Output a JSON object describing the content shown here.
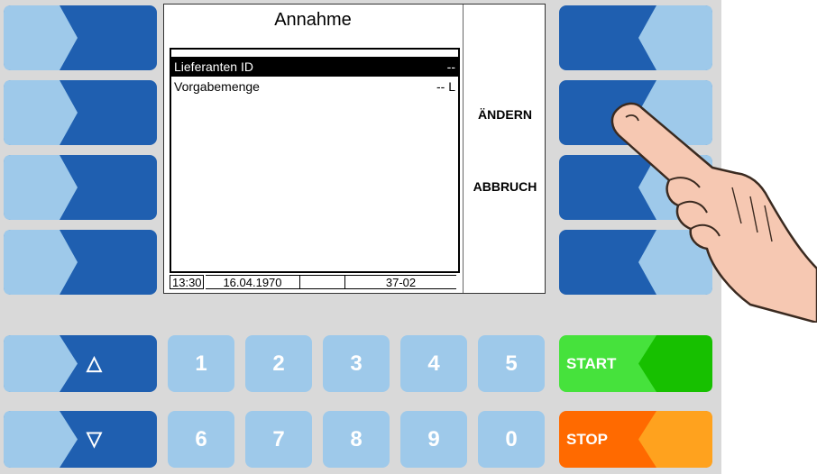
{
  "screen": {
    "title": "Annahme",
    "rows": [
      {
        "label": "Lieferanten ID",
        "value": "--",
        "selected": true
      },
      {
        "label": "Vorgabemenge",
        "value": "-- L",
        "selected": false
      }
    ],
    "softkeys": {
      "change": "ÄNDERN",
      "abort": "ABBRUCH"
    },
    "status": {
      "time": "13:30",
      "date": "16.04.1970",
      "code": "37-02"
    }
  },
  "keypad": {
    "digits_top": [
      "1",
      "2",
      "3",
      "4",
      "5"
    ],
    "digits_bottom": [
      "6",
      "7",
      "8",
      "9",
      "0"
    ],
    "up_symbol": "△",
    "down_symbol": "▽",
    "start_label": "START",
    "stop_label": "STOP"
  },
  "colors": {
    "dark_blue": "#1f5fb0",
    "light_blue": "#9ec9ea",
    "panel_gray": "#d9d9d9",
    "start_green": "#17c000",
    "start_light_green": "#46e23c",
    "stop_orange": "#ff6a00",
    "stop_light_orange": "#ffa21e"
  },
  "icons": {
    "hand": "pointing-hand-icon",
    "up": "triangle-up-icon",
    "down": "triangle-down-icon"
  }
}
